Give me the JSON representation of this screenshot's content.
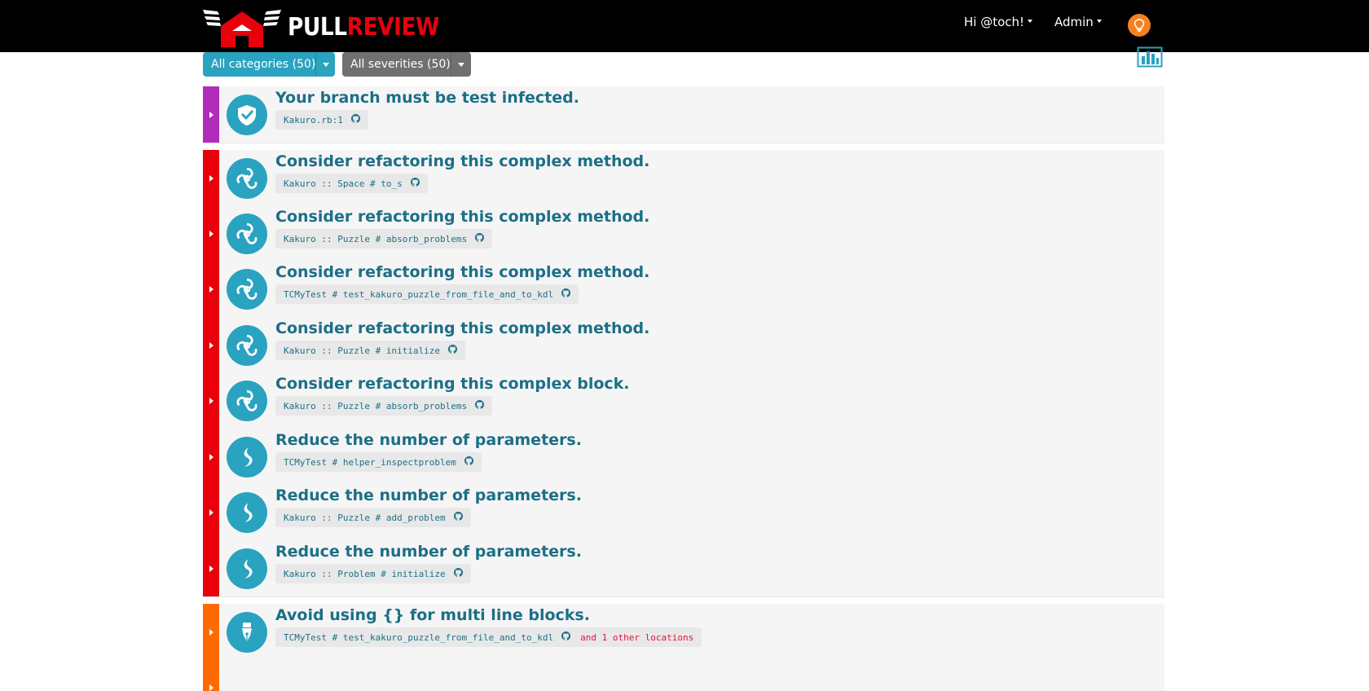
{
  "brand": {
    "part1": "PULL",
    "part2": "REVIEW"
  },
  "nav": {
    "user": "Hi @toch!",
    "admin": "Admin"
  },
  "filters": {
    "categories": "All categories (50)",
    "severities": "All severities (50)"
  },
  "colors": {
    "navbar": "#000000",
    "brand_red": "#e8000c",
    "accent_blue": "#2aa3c0",
    "title_blue": "#1c6f87",
    "severity_purple": "#b12cbb",
    "severity_red": "#e8000c",
    "severity_orange": "#ff6a00",
    "bulb_orange": "#f58220"
  },
  "issues": [
    {
      "title": "Your branch must be test infected.",
      "location": "Kakuro.rb:1",
      "icon": "check-shield-icon",
      "severity_color": "#b12cbb",
      "extra": ""
    },
    {
      "title": "Consider refactoring this complex method.",
      "location": "Kakuro :: Space # to_s",
      "icon": "complexity-icon",
      "severity_color": "#e8000c",
      "extra": ""
    },
    {
      "title": "Consider refactoring this complex method.",
      "location": "Kakuro :: Puzzle # absorb_problems",
      "icon": "complexity-icon",
      "severity_color": "#e8000c",
      "extra": ""
    },
    {
      "title": "Consider refactoring this complex method.",
      "location": "TCMyTest # test_kakuro_puzzle_from_file_and_to_kdl",
      "icon": "complexity-icon",
      "severity_color": "#e8000c",
      "extra": ""
    },
    {
      "title": "Consider refactoring this complex method.",
      "location": "Kakuro :: Puzzle # initialize",
      "icon": "complexity-icon",
      "severity_color": "#e8000c",
      "extra": ""
    },
    {
      "title": "Consider refactoring this complex block.",
      "location": "Kakuro :: Puzzle # absorb_problems",
      "icon": "complexity-icon",
      "severity_color": "#e8000c",
      "extra": ""
    },
    {
      "title": "Reduce the number of parameters.",
      "location": "TCMyTest # helper_inspectproblem",
      "icon": "parameters-icon",
      "severity_color": "#e8000c",
      "extra": ""
    },
    {
      "title": "Reduce the number of parameters.",
      "location": "Kakuro :: Puzzle # add_problem",
      "icon": "parameters-icon",
      "severity_color": "#e8000c",
      "extra": ""
    },
    {
      "title": "Reduce the number of parameters.",
      "location": "Kakuro :: Problem # initialize",
      "icon": "parameters-icon",
      "severity_color": "#e8000c",
      "extra": ""
    },
    {
      "title": "Avoid using {} for multi line blocks.",
      "location": "TCMyTest # test_kakuro_puzzle_from_file_and_to_kdl",
      "icon": "style-pen-icon",
      "severity_color": "#ff6a00",
      "extra": "and 1 other locations"
    },
    {
      "title": "",
      "location": "",
      "icon": "",
      "severity_color": "#ff6a00",
      "extra": ""
    }
  ]
}
